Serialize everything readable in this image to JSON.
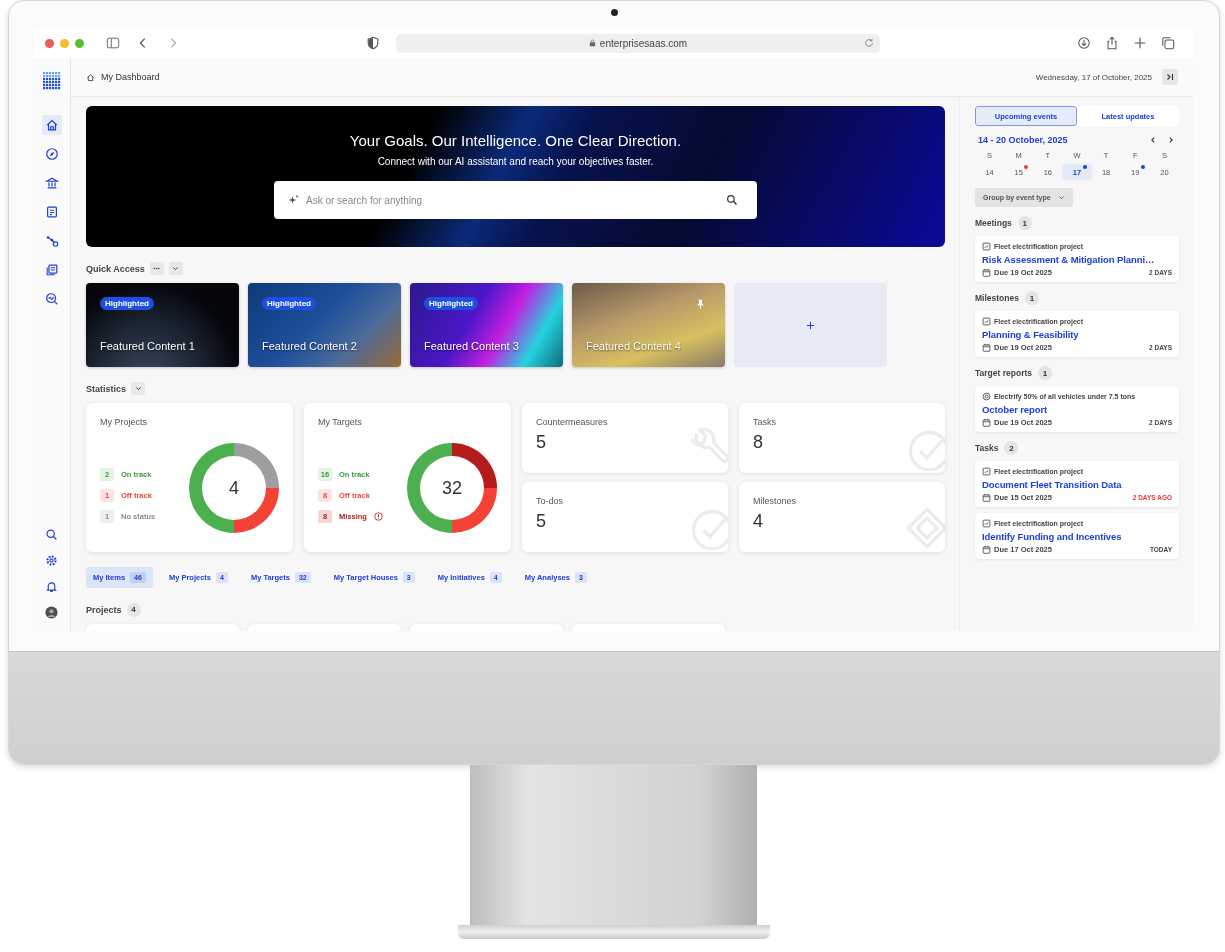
{
  "browser": {
    "url": "enterprisesaas.com"
  },
  "header": {
    "breadcrumb": "My Dashboard",
    "date": "Wednesday, 17 of October, 2025"
  },
  "sidebar": {
    "items": [
      {
        "selected": true
      },
      {
        "selected": false
      },
      {
        "selected": false
      },
      {
        "selected": false
      },
      {
        "selected": false
      },
      {
        "selected": false
      },
      {
        "selected": false
      }
    ]
  },
  "hero": {
    "title": "Your Goals. Our Intelligence. One Clear Direction.",
    "subtitle": "Connect with our AI assistant and reach your objectives faster.",
    "search": {
      "placeholder": "Ask or search for anything"
    }
  },
  "quick_access": {
    "title": "Quick Access",
    "cards": [
      {
        "kind": "content",
        "title": "Featured Content 1",
        "badge": "Highlighted",
        "pinned": false
      },
      {
        "kind": "content",
        "title": "Featured Content 2",
        "badge": "Highlighted",
        "pinned": false
      },
      {
        "kind": "content",
        "title": "Featured Content 3",
        "badge": "Highlighted",
        "pinned": false
      },
      {
        "kind": "content",
        "title": "Featured Content 4",
        "pinned": true
      },
      {
        "kind": "add"
      }
    ]
  },
  "statistics": {
    "title": "Statistics",
    "charts": [
      {
        "title": "My Projects",
        "total": "4",
        "legend": [
          {
            "count": "2",
            "label": "On track",
            "kind": "on_track"
          },
          {
            "count": "1",
            "label": "Off track",
            "kind": "off_track"
          },
          {
            "count": "1",
            "label": "No status",
            "kind": "none"
          }
        ],
        "chart_data": {
          "type": "donut",
          "values": [
            50,
            25,
            25
          ]
        }
      },
      {
        "title": "My Targets",
        "total": "32",
        "legend": [
          {
            "count": "16",
            "label": "On track",
            "kind": "on_track"
          },
          {
            "count": "8",
            "label": "Off track",
            "kind": "off_track"
          },
          {
            "count": "8",
            "label": "Missing",
            "kind": "missing"
          }
        ],
        "chart_data": {
          "type": "donut",
          "values": [
            50,
            25,
            25
          ]
        }
      }
    ],
    "counters": [
      {
        "title": "Countermeasures",
        "value": "5",
        "kind": "wrench"
      },
      {
        "title": "Tasks",
        "value": "8",
        "kind": "check"
      },
      {
        "title": "To-dos",
        "value": "5",
        "kind": "check"
      },
      {
        "title": "Milestones",
        "value": "4",
        "kind": "diamond"
      }
    ]
  },
  "item_tabs": [
    {
      "label": "My Items",
      "count": "46",
      "selected": true
    },
    {
      "label": "My Projects",
      "count": "4",
      "selected": false
    },
    {
      "label": "My Targets",
      "count": "32",
      "selected": false
    },
    {
      "label": "My Target Houses",
      "count": "3",
      "selected": false
    },
    {
      "label": "My Initiatives",
      "count": "4",
      "selected": false
    },
    {
      "label": "My Analyses",
      "count": "3",
      "selected": false
    }
  ],
  "projects": {
    "title": "Projects",
    "count": "4",
    "cards": [
      {
        "kind": "project"
      },
      {
        "kind": "project"
      },
      {
        "kind": "project"
      },
      {
        "kind": "project"
      }
    ]
  },
  "panel": {
    "tabs": [
      {
        "label": "Upcoming events",
        "selected": true
      },
      {
        "label": "Latest updates",
        "selected": false
      }
    ],
    "week": "14 - 20 October, 2025",
    "days": [
      {
        "weekday": "S",
        "date": "14",
        "selected": false
      },
      {
        "weekday": "M",
        "date": "15",
        "selected": false,
        "color": "#e53935"
      },
      {
        "weekday": "T",
        "date": "16",
        "selected": false
      },
      {
        "weekday": "W",
        "date": "17",
        "selected": true,
        "color": "#1e40d8"
      },
      {
        "weekday": "T",
        "date": "18",
        "selected": false
      },
      {
        "weekday": "F",
        "date": "19",
        "selected": false,
        "color": "#1e40d8"
      },
      {
        "weekday": "S",
        "date": "20",
        "selected": false
      }
    ],
    "group_by": "Group by event type",
    "sections": [
      {
        "title": "Meetings",
        "count": "1",
        "items": [
          {
            "source": "Fleet electrification project",
            "kind": "project",
            "title": "Risk Assessment & Mitigation Planni…",
            "due": "Due 19 Oct 2025",
            "remaining": "2 DAYS",
            "overdue": false
          }
        ]
      },
      {
        "title": "Milestones",
        "count": "1",
        "items": [
          {
            "source": "Fleet electrification project",
            "kind": "project",
            "title": "Planning & Feasibility",
            "due": "Due 19 Oct 2025",
            "remaining": "2 DAYS",
            "overdue": false
          }
        ]
      },
      {
        "title": "Target reports",
        "count": "1",
        "items": [
          {
            "source": "Electrify 50% of all vehicles under 7.5 tons",
            "kind": "target",
            "title": "October report",
            "due": "Due 19 Oct 2025",
            "remaining": "2 DAYS",
            "overdue": false
          }
        ]
      },
      {
        "title": "Tasks",
        "count": "2",
        "items": [
          {
            "source": "Fleet electrification project",
            "kind": "project",
            "title": "Document Fleet Transition Data",
            "due": "Due 15 Oct 2025",
            "remaining": "2 DAYS AGO",
            "overdue": true
          },
          {
            "source": "Fleet electrification project",
            "kind": "project",
            "title": "Identify Funding and Incentives",
            "due": "Due 17 Oct 2025",
            "remaining": "TODAY",
            "overdue": false
          }
        ]
      }
    ]
  }
}
